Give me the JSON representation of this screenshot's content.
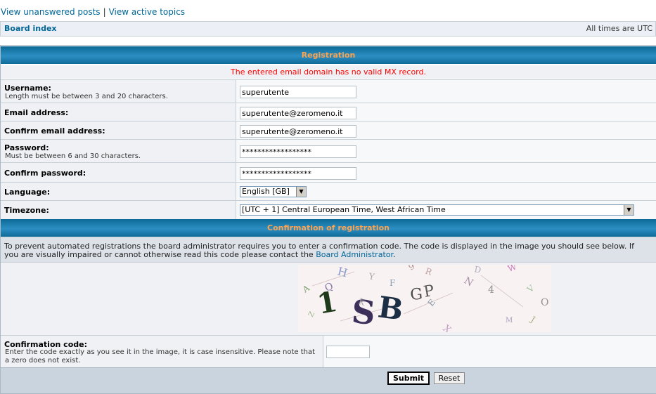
{
  "top_links": {
    "unanswered": "View unanswered posts",
    "separator": "|",
    "active": "View active topics"
  },
  "breadcrumb": {
    "board_index": "Board index",
    "timezone_note": "All times are UTC"
  },
  "registration": {
    "title": "Registration",
    "error": "The entered email domain has no valid MX record.",
    "username": {
      "label": "Username:",
      "hint": "Length must be between 3 and 20 characters.",
      "value": "superutente"
    },
    "email": {
      "label": "Email address:",
      "value": "superutente@zeromeno.it"
    },
    "confirm_email": {
      "label": "Confirm email address:",
      "value": "superutente@zeromeno.it"
    },
    "password": {
      "label": "Password:",
      "hint": "Must be between 6 and 30 characters.",
      "value": "******************"
    },
    "confirm_password": {
      "label": "Confirm password:",
      "value": "******************"
    },
    "language": {
      "label": "Language:",
      "value": "English [GB]"
    },
    "timezone": {
      "label": "Timezone:",
      "value": "[UTC + 1] Central European Time, West African Time"
    }
  },
  "confirmation": {
    "title": "Confirmation of registration",
    "explain_text": "To prevent automated registrations the board administrator requires you to enter a confirmation code. The code is displayed in the image you should see below. If you are visually impaired or cannot otherwise read this code please contact the",
    "admin_link": "Board Administrator",
    "explain_end": ".",
    "code_label": "Confirmation code:",
    "code_hint": "Enter the code exactly as you see it in the image, it is case insensitive. Please note that a zero does not exist.",
    "code_value": ""
  },
  "buttons": {
    "submit": "Submit",
    "reset": "Reset"
  },
  "captcha_glyphs": [
    {
      "t": "1",
      "c": "#1f3a1a"
    },
    {
      "t": "S",
      "c": "#3c2f5a"
    },
    {
      "t": "B",
      "c": "#1c2e44"
    },
    {
      "t": "G",
      "c": "#4a4a4a"
    },
    {
      "t": "P",
      "c": "#5a5a5a"
    },
    {
      "t": "H",
      "c": "#8a9ac8"
    },
    {
      "t": "Q",
      "c": "#8a7aa8"
    },
    {
      "t": "A",
      "c": "#7a9a6a"
    },
    {
      "t": "Y",
      "c": "#a8a8a8"
    },
    {
      "t": "R",
      "c": "#c0a0a0"
    },
    {
      "t": "9",
      "c": "#b09090"
    },
    {
      "t": "F",
      "c": "#8aa0b8"
    },
    {
      "t": "Z",
      "c": "#9ab088"
    },
    {
      "t": "N",
      "c": "#aa90a8"
    },
    {
      "t": "X",
      "c": "#c8a0c8"
    },
    {
      "t": "4",
      "c": "#909090"
    },
    {
      "t": "W",
      "c": "#c878b8"
    },
    {
      "t": "J",
      "c": "#a8b080"
    },
    {
      "t": "M",
      "c": "#a8a0c0"
    },
    {
      "t": "E",
      "c": "#8898a8"
    },
    {
      "t": "K",
      "c": "#a0a0a0"
    },
    {
      "t": "D",
      "c": "#b0b0c0"
    },
    {
      "t": "V",
      "c": "#a0c0a0"
    },
    {
      "t": "O",
      "c": "#909090"
    }
  ]
}
